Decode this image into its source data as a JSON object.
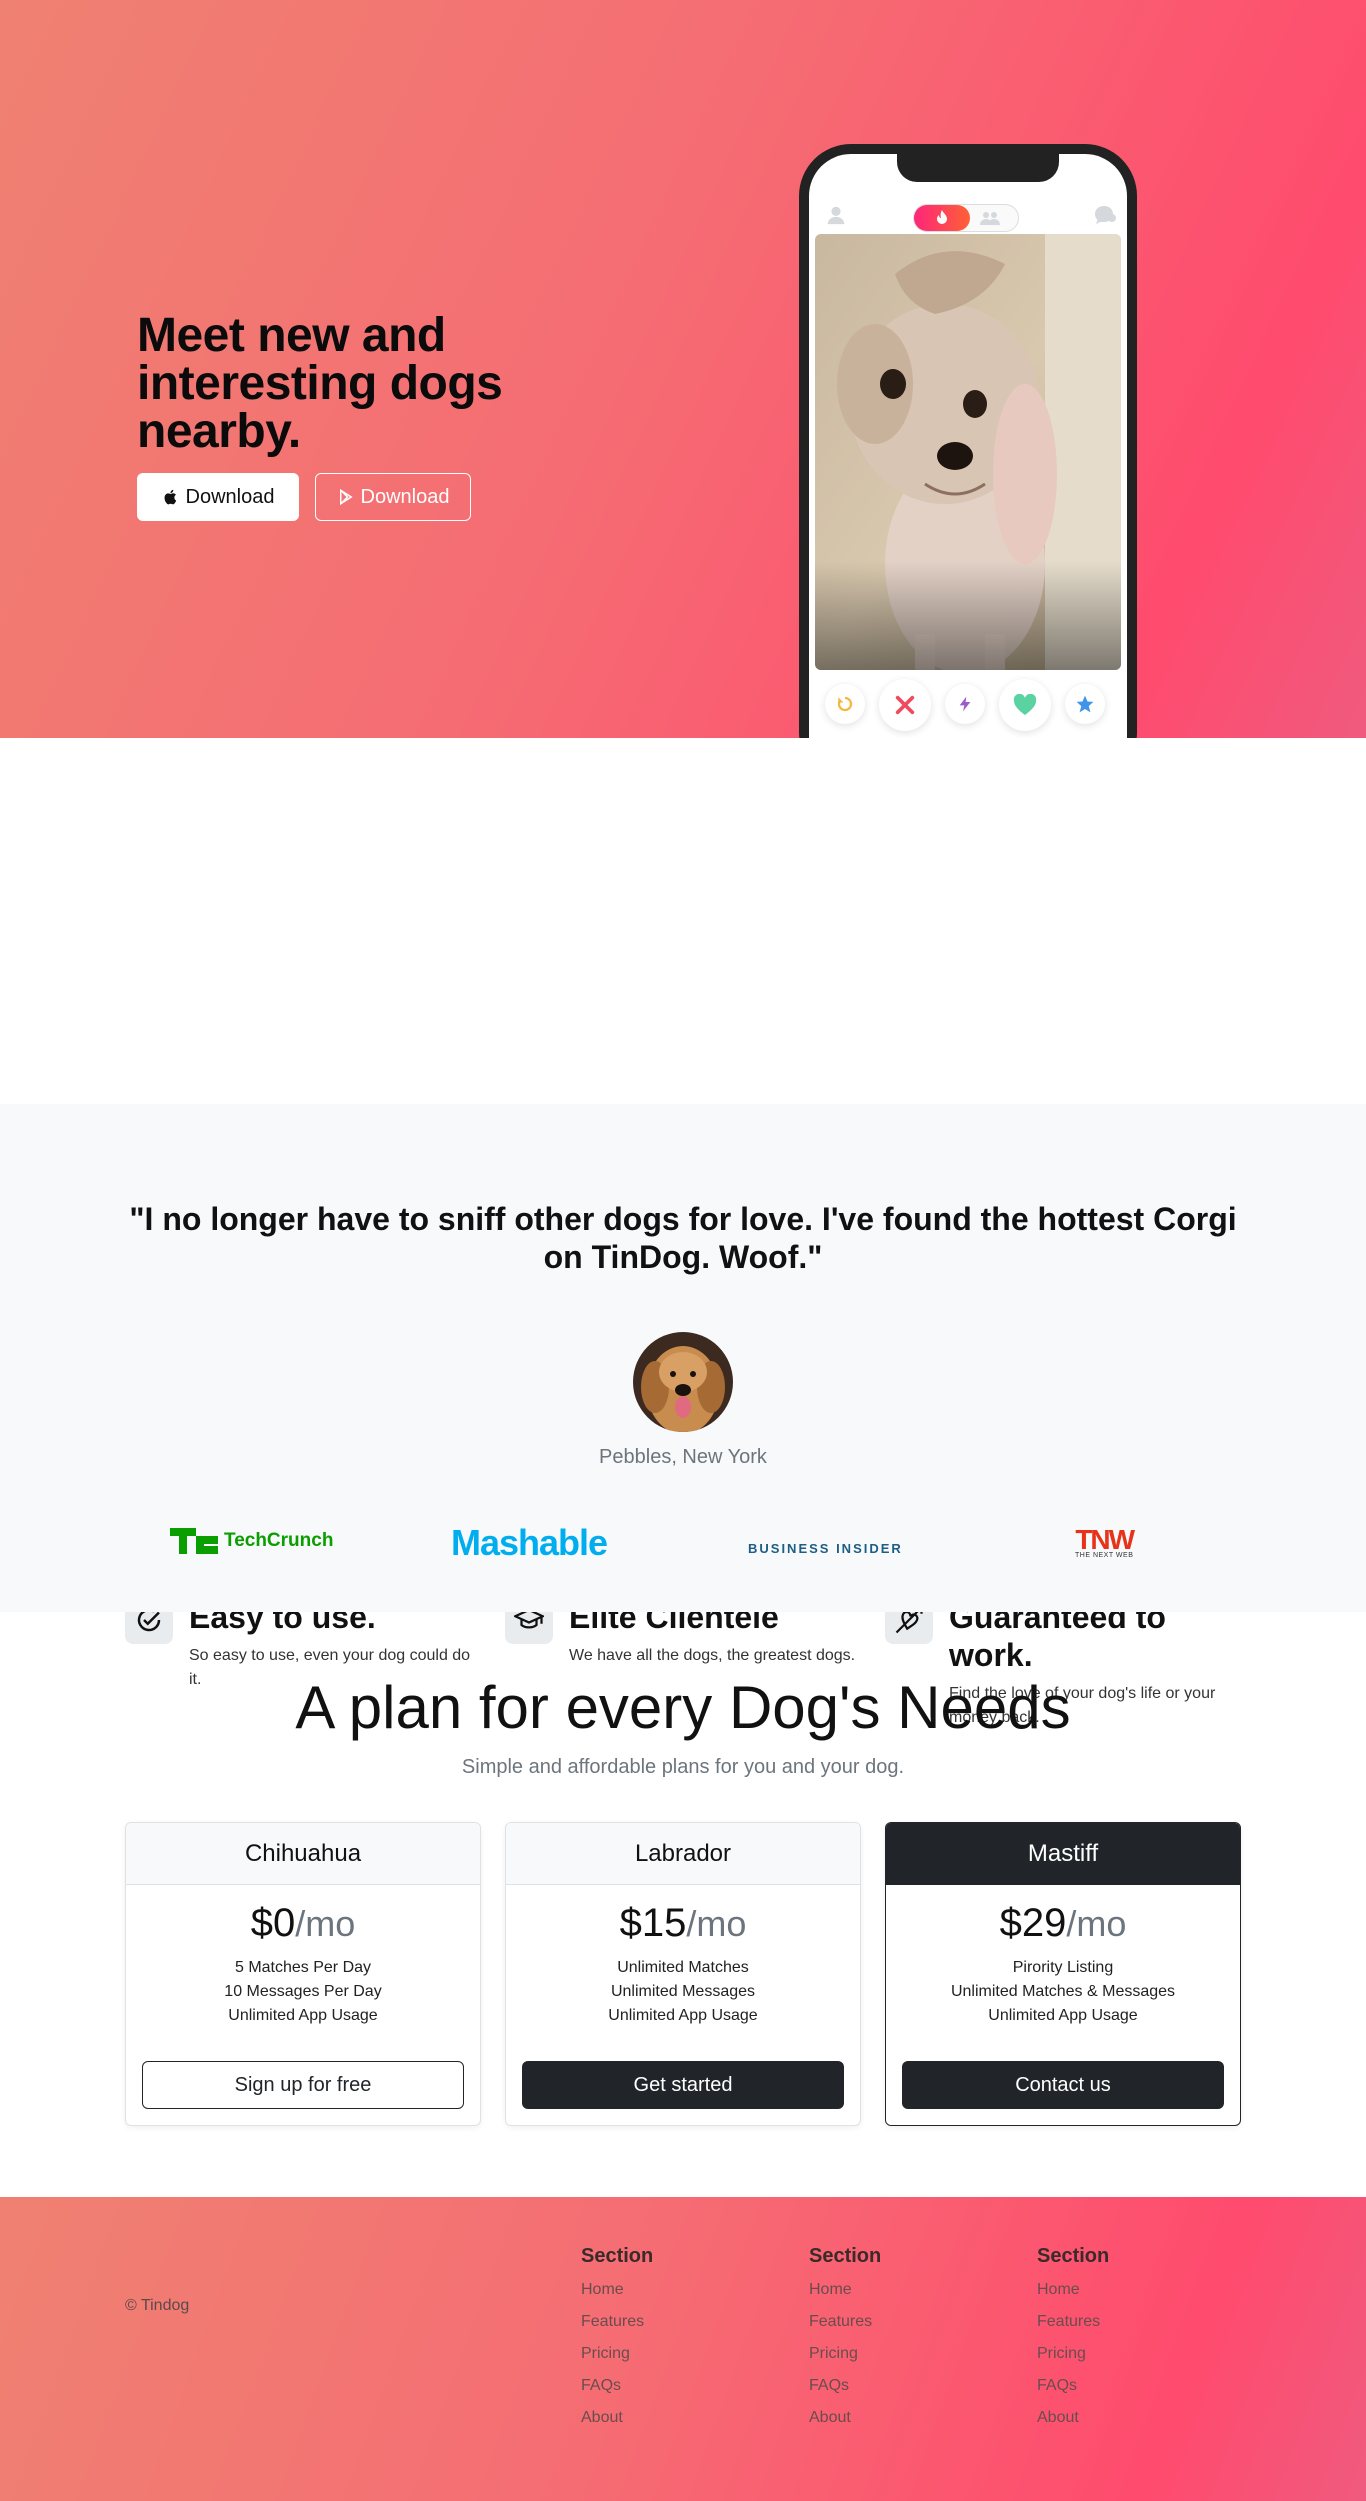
{
  "hero": {
    "title": "Meet new and interesting dogs nearby.",
    "apple_button": "Download",
    "play_button": "Download"
  },
  "features": [
    {
      "title": "Easy to use.",
      "text": "So easy to use, even your dog could do it.",
      "icon": "circle-check-icon"
    },
    {
      "title": "Elite Clientele",
      "text": "We have all the dogs, the greatest dogs.",
      "icon": "graduation-cap-icon"
    },
    {
      "title": "Guaranteed to work.",
      "text": "Find the love of your dog's life or your money back.",
      "icon": "heart-arrow-icon"
    }
  ],
  "testimonial": {
    "quote": "\"I no longer have to sniff other dogs for love. I've found the hottest Corgi on TinDog. Woof.\"",
    "author": "Pebbles, New York"
  },
  "press": {
    "techcrunch": "TechCrunch",
    "mashable": "Mashable",
    "business_insider": "BUSINESS INSIDER",
    "tnw": "TNW",
    "tnw_sub": "THE NEXT WEB"
  },
  "pricing": {
    "title": "A plan for every Dog's Needs",
    "subtitle": "Simple and affordable plans for you and your dog.",
    "plans": [
      {
        "name": "Chihuahua",
        "price": "$0",
        "per": "/mo",
        "features": [
          "5 Matches Per Day",
          "10 Messages Per Day",
          "Unlimited App Usage"
        ],
        "button": "Sign up for free"
      },
      {
        "name": "Labrador",
        "price": "$15",
        "per": "/mo",
        "features": [
          "Unlimited Matches",
          "Unlimited Messages",
          "Unlimited App Usage"
        ],
        "button": "Get started"
      },
      {
        "name": "Mastiff",
        "price": "$29",
        "per": "/mo",
        "features": [
          "Pirority Listing",
          "Unlimited Matches & Messages",
          "Unlimited App Usage"
        ],
        "button": "Contact us"
      }
    ]
  },
  "footer": {
    "copyright": "© Tindog",
    "columns": [
      {
        "heading": "Section",
        "links": [
          "Home",
          "Features",
          "Pricing",
          "FAQs",
          "About"
        ]
      },
      {
        "heading": "Section",
        "links": [
          "Home",
          "Features",
          "Pricing",
          "FAQs",
          "About"
        ]
      },
      {
        "heading": "Section",
        "links": [
          "Home",
          "Features",
          "Pricing",
          "FAQs",
          "About"
        ]
      }
    ]
  },
  "colors": {
    "brand_gradient_start": "#ef8172",
    "brand_gradient_end": "#ff4b6e",
    "dark": "#212529",
    "muted": "#6c757d"
  }
}
